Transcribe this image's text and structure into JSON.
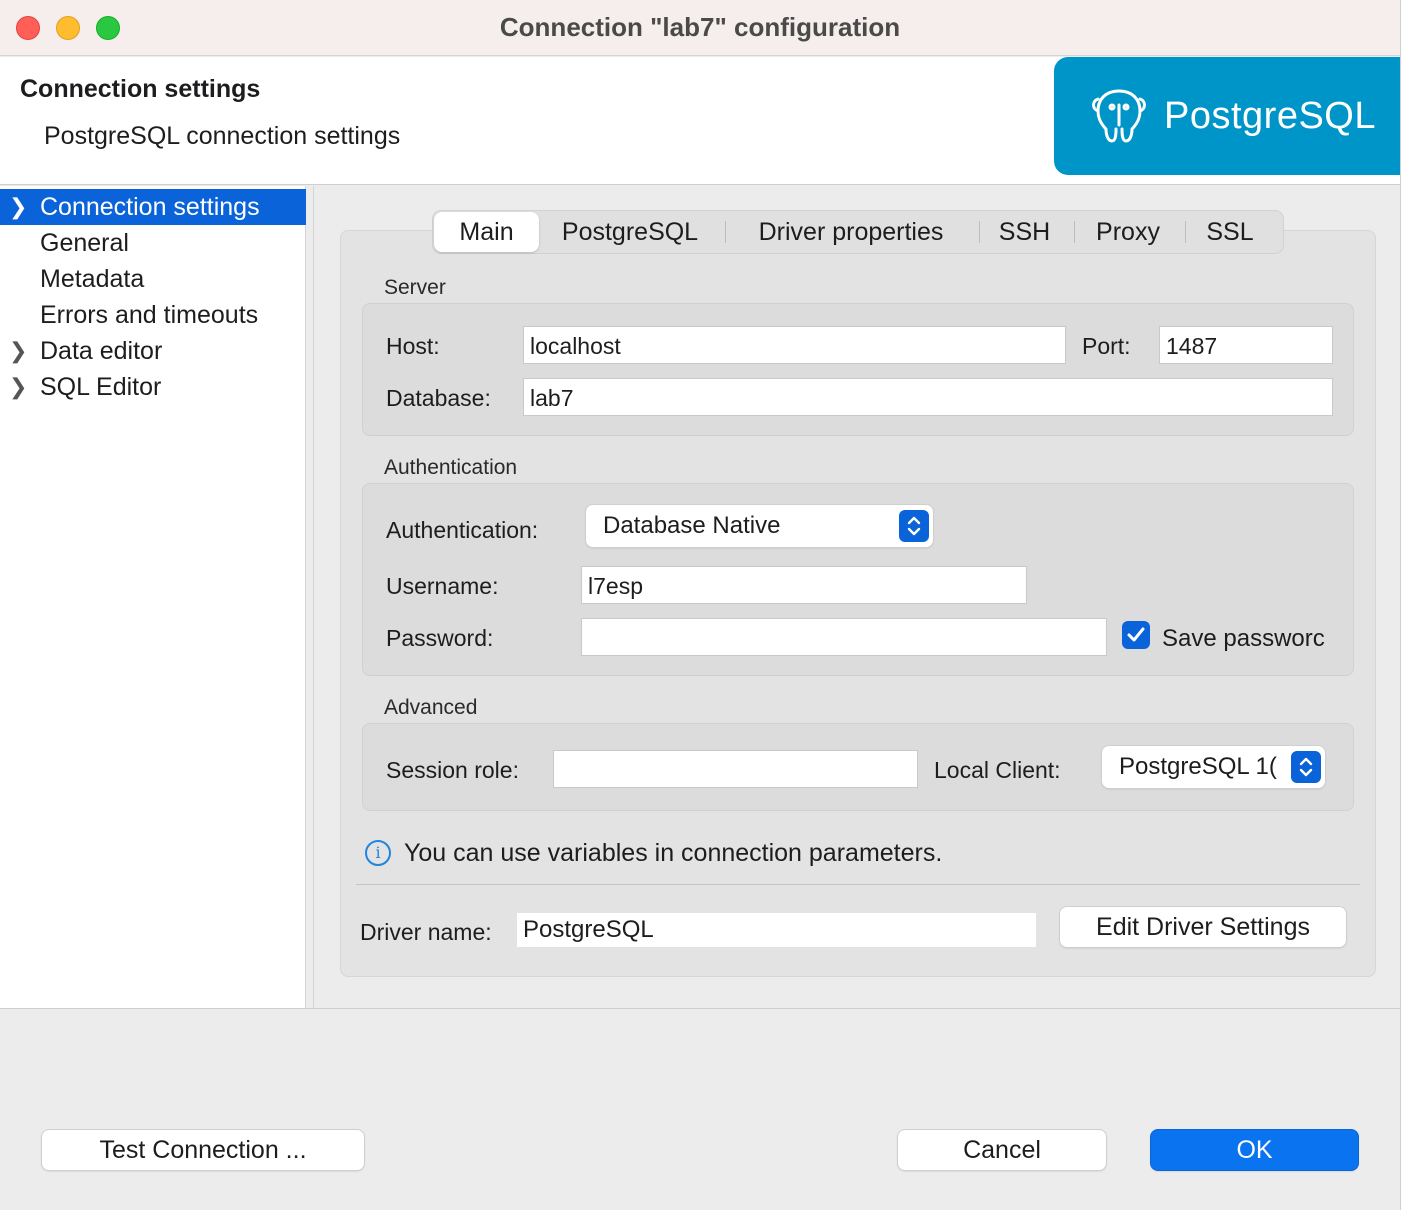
{
  "window": {
    "title": "Connection \"lab7\" configuration"
  },
  "header": {
    "title": "Connection settings",
    "subtitle": "PostgreSQL connection settings",
    "logo_text": "PostgreSQL",
    "logo_color": "#0095c8"
  },
  "sidebar": {
    "items": [
      {
        "label": "Connection settings",
        "expandable": true,
        "selected": true
      },
      {
        "label": "General",
        "expandable": false
      },
      {
        "label": "Metadata",
        "expandable": false
      },
      {
        "label": "Errors and timeouts",
        "expandable": false
      },
      {
        "label": "Data editor",
        "expandable": true
      },
      {
        "label": "SQL Editor",
        "expandable": true
      }
    ]
  },
  "tabs": [
    {
      "label": "Main",
      "active": true
    },
    {
      "label": "PostgreSQL"
    },
    {
      "label": "Driver properties"
    },
    {
      "label": "SSH"
    },
    {
      "label": "Proxy"
    },
    {
      "label": "SSL"
    }
  ],
  "server": {
    "section_label": "Server",
    "host_label": "Host:",
    "host_value": "localhost",
    "port_label": "Port:",
    "port_value": "1487",
    "database_label": "Database:",
    "database_value": "lab7"
  },
  "auth": {
    "section_label": "Authentication",
    "auth_label": "Authentication:",
    "auth_value": "Database Native",
    "username_label": "Username:",
    "username_value": "l7esp",
    "password_label": "Password:",
    "password_value": "",
    "save_password_label": "Save passworc",
    "save_password_checked": true
  },
  "advanced": {
    "section_label": "Advanced",
    "session_role_label": "Session role:",
    "session_role_value": "",
    "local_client_label": "Local Client:",
    "local_client_value": "PostgreSQL 1("
  },
  "info": {
    "text": "You can use variables in connection parameters."
  },
  "driver": {
    "label": "Driver name:",
    "value": "PostgreSQL",
    "edit_button": "Edit Driver Settings"
  },
  "footer": {
    "test_button": "Test Connection ...",
    "cancel_button": "Cancel",
    "ok_button": "OK"
  },
  "colors": {
    "accent": "#0a63d9",
    "ok_button": "#0a74f0",
    "info": "#1f86e0"
  }
}
